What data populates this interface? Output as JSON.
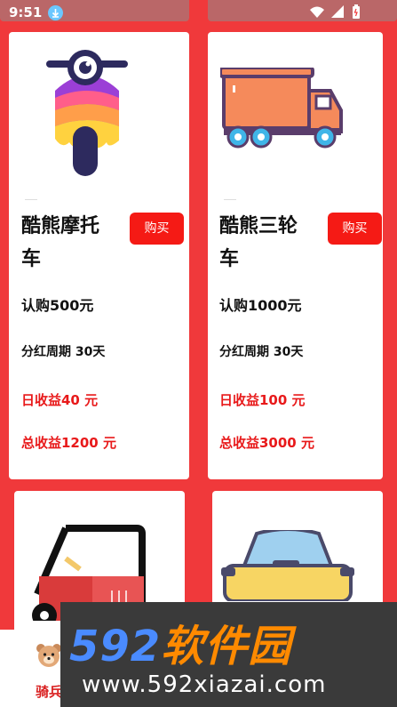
{
  "status": {
    "time": "9:51"
  },
  "cards": [
    {
      "title_line1": "酷熊摩托",
      "title_line2": "车",
      "buy_label": "购买",
      "price": "认购500元",
      "period": "分红周期 30天",
      "daily": "日收益40 元",
      "total": "总收益1200 元"
    },
    {
      "title_line1": "酷熊三轮",
      "title_line2": "车",
      "buy_label": "购买",
      "price": "认购1000元",
      "period": "分红周期 30天",
      "daily": "日收益100 元",
      "total": "总收益3000 元"
    }
  ],
  "bottom_nav": {
    "label": "骑兵"
  },
  "watermark": {
    "brand_num": "592",
    "brand_cn": "软件园",
    "url": "www.592xiazai.com"
  },
  "icons": [
    "download-icon",
    "wifi-icon",
    "signal-icon",
    "battery-icon",
    "motorcycle-icon",
    "truck-icon",
    "cart-icon",
    "car-icon",
    "bear-avatar-icon"
  ]
}
